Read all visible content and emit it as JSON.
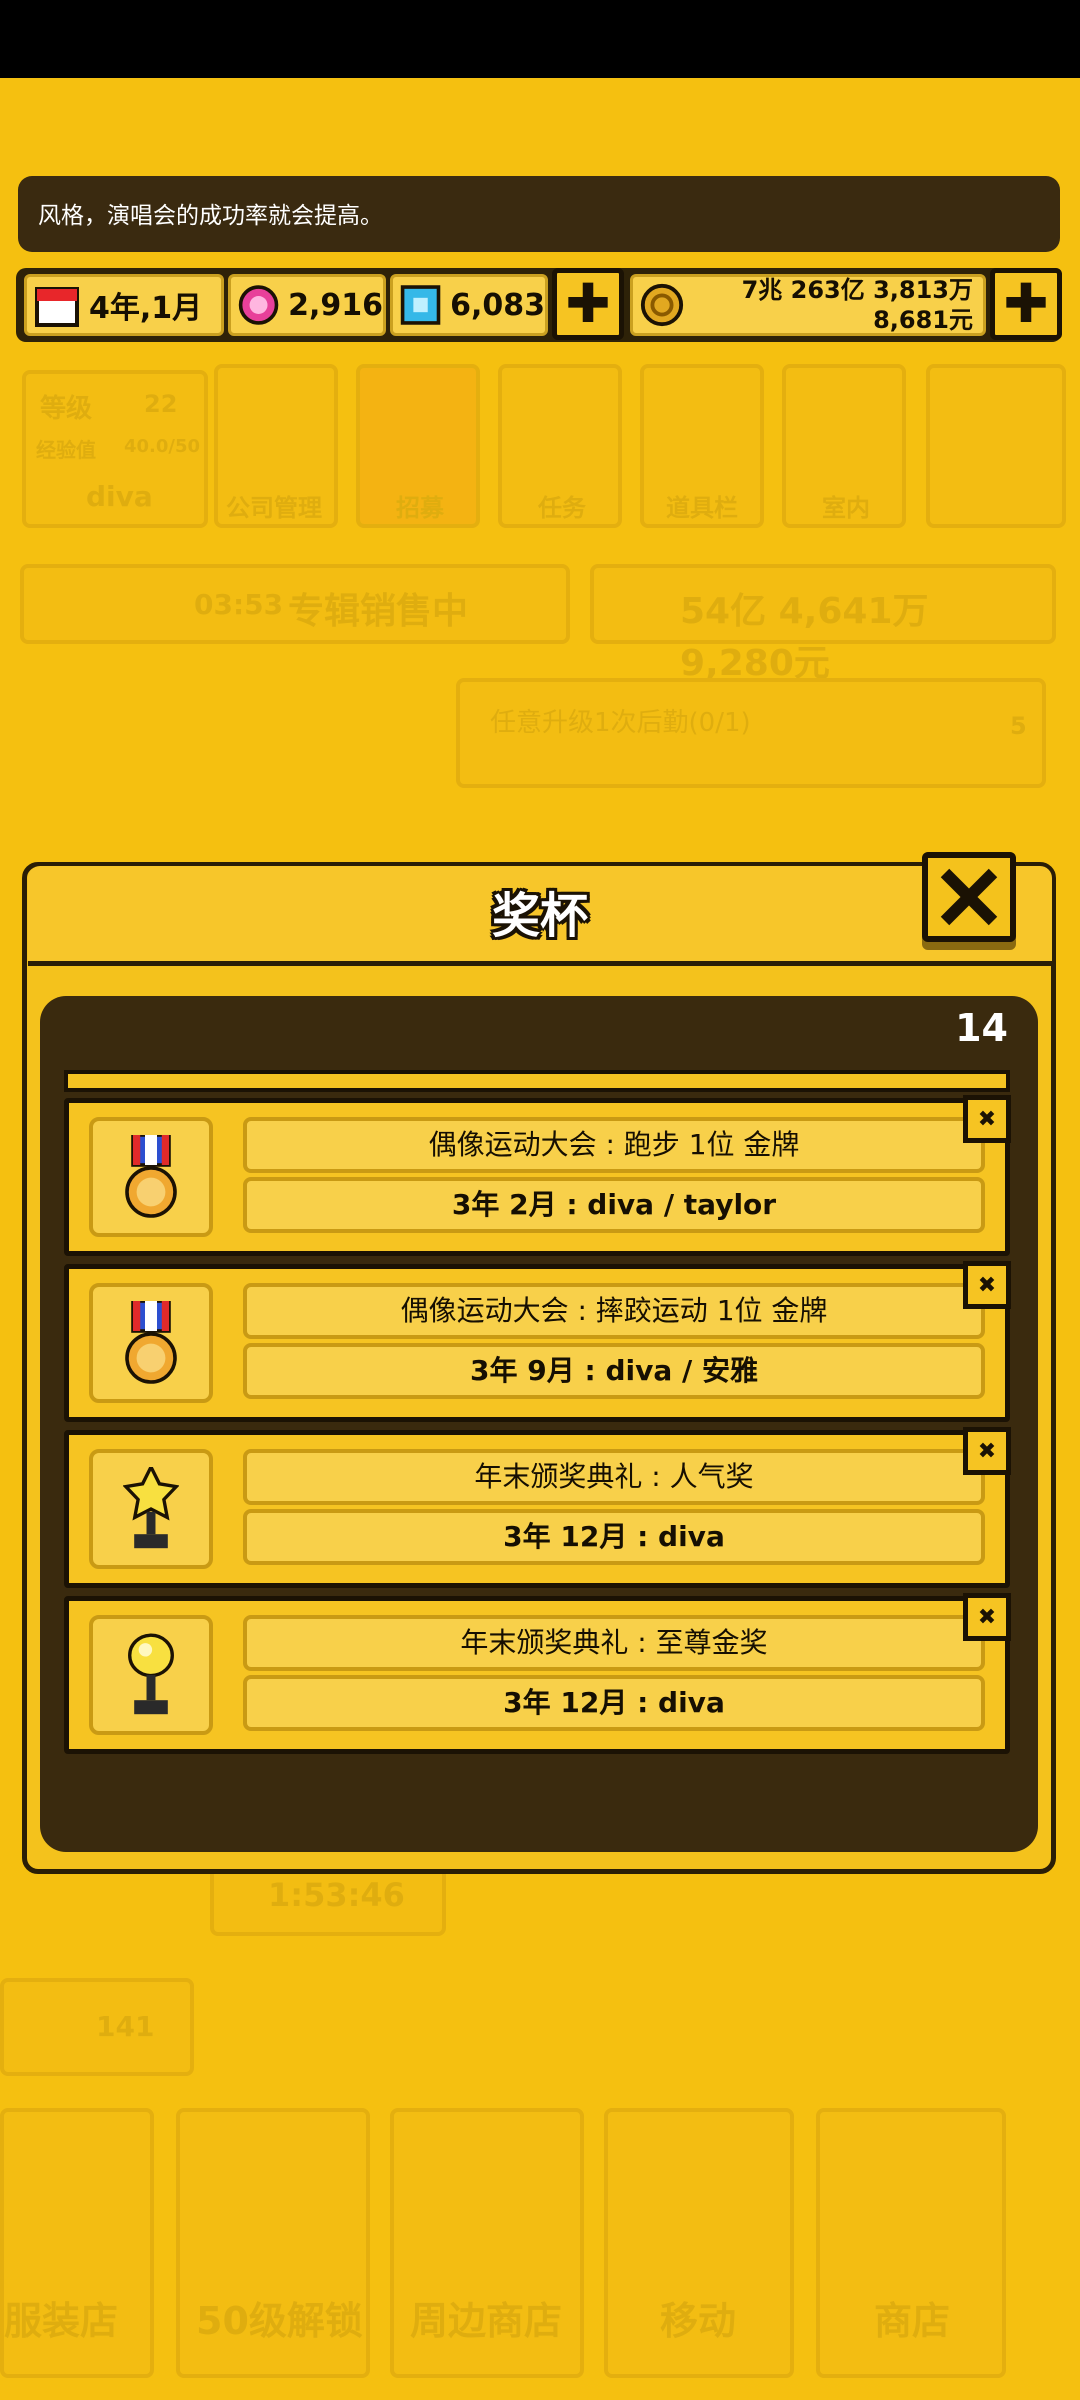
{
  "tip": "风格，演唱会的成功率就会提高。",
  "resources": {
    "date": "4年,1月",
    "gems_pink": "2,916",
    "gems_blue": "6,083",
    "money_line1": "7兆 263亿 3,813万",
    "money_line2": "8,681元",
    "plus_label": "✚"
  },
  "background": {
    "level_label": "等级",
    "level_value": "22",
    "exp_label": "经验值",
    "exp_value": "40.0/50",
    "player_name": "diva",
    "menu": [
      "公司管理",
      "招募",
      "任务",
      "道具栏",
      "室内"
    ],
    "timer": "03:53",
    "album_status": "专辑销售中",
    "album_money": "54亿 4,641万 9,280元",
    "quest_text": "任意升级1次后勤(0/1)",
    "quest_reward": "5",
    "countdown": "1:53:46",
    "stars": "141",
    "bottom_nav": [
      "服装店",
      "50级解锁",
      "周边商店",
      "移动",
      "商店"
    ]
  },
  "dialog": {
    "title": "奖杯",
    "close_icon": "close-x-icon",
    "count": "14",
    "trophies": [
      {
        "icon": "medal-icon",
        "name": "偶像运动大会 : 跑步 1位 金牌",
        "detail": "3年 2月 : diva / taylor"
      },
      {
        "icon": "medal-icon",
        "name": "偶像运动大会 : 摔跤运动 1位 金牌",
        "detail": "3年 9月 : diva / 安雅"
      },
      {
        "icon": "star-trophy-icon",
        "name": "年末颁奖典礼 : 人气奖",
        "detail": "3年 12月 : diva"
      },
      {
        "icon": "gold-trophy-icon",
        "name": "年末颁奖典礼 : 至尊金奖",
        "detail": "3年 12月 : diva"
      }
    ]
  },
  "colors": {
    "background": "#f5c010",
    "panel": "#f6c422",
    "dark": "#3a2a0e",
    "outline": "#1b1204"
  }
}
